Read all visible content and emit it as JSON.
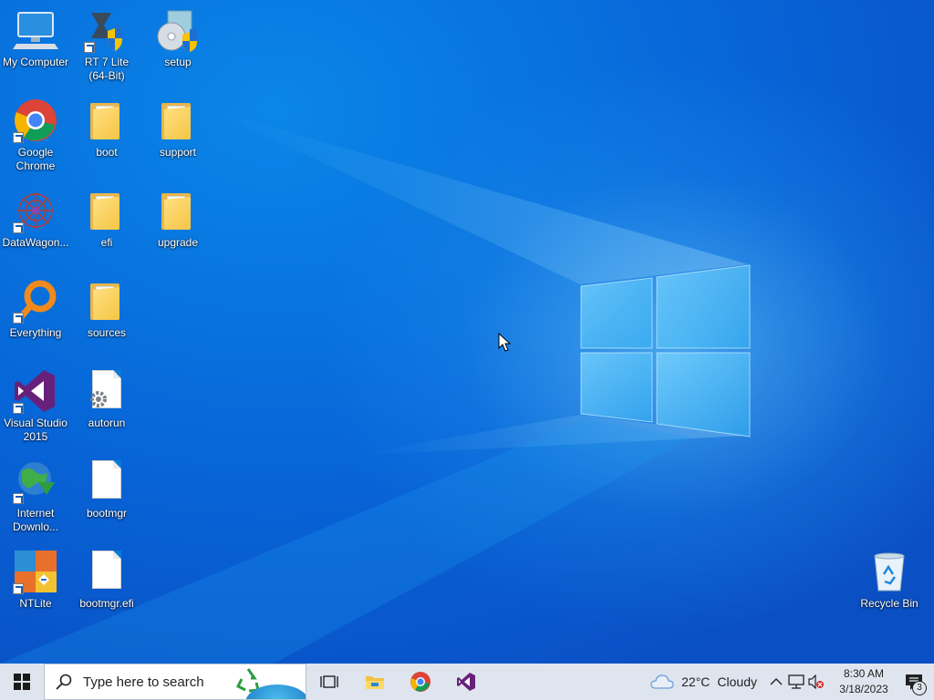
{
  "desktop": {
    "icons": [
      {
        "label": "My Computer",
        "type": "computer"
      },
      {
        "label": "RT 7 Lite\n(64-Bit)",
        "type": "app"
      },
      {
        "label": "setup",
        "type": "setup"
      },
      {
        "label": "Google Chrome",
        "type": "chrome"
      },
      {
        "label": "boot",
        "type": "folder"
      },
      {
        "label": "support",
        "type": "folder"
      },
      {
        "label": "DataWagon...",
        "type": "app"
      },
      {
        "label": "efi",
        "type": "folder"
      },
      {
        "label": "upgrade",
        "type": "folder"
      },
      {
        "label": "Everything",
        "type": "app"
      },
      {
        "label": "sources",
        "type": "folder"
      },
      {
        "label": "Visual Studio 2015",
        "type": "vs"
      },
      {
        "label": "autorun",
        "type": "file"
      },
      {
        "label": "Internet Downlo...",
        "type": "app"
      },
      {
        "label": "bootmgr",
        "type": "file"
      },
      {
        "label": "NTLite",
        "type": "app"
      },
      {
        "label": "bootmgr.efi",
        "type": "file"
      },
      {
        "label": "Recycle Bin",
        "type": "recycle"
      }
    ]
  },
  "taskbar": {
    "start_icon": "windows-logo-icon",
    "search_placeholder": "Type here to search",
    "pinned": [
      "task-view-icon",
      "file-explorer-icon",
      "chrome-icon",
      "visual-studio-icon"
    ],
    "weather": {
      "temp": "22°C",
      "condition": "Cloudy"
    },
    "clock": {
      "time": "8:30 AM",
      "date": "3/18/2023"
    },
    "notification_count": "3"
  },
  "colors": {
    "accent": "#0a78d7",
    "taskbar": "#dfe5ee"
  }
}
